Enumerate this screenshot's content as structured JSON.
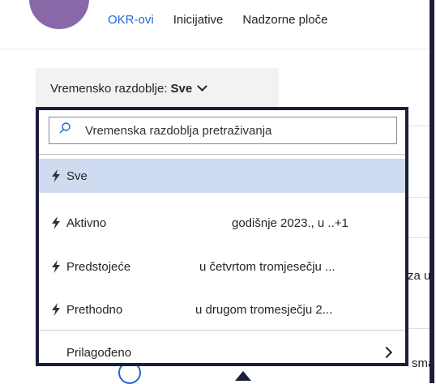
{
  "tabs": [
    {
      "label": "OKR-ovi"
    },
    {
      "label": "Inicijative"
    },
    {
      "label": "Nadzorne ploče"
    }
  ],
  "period_filter": {
    "label": "Vremensko razdoblje:",
    "value": "Sve"
  },
  "background_fragments": {
    "row_a": "za u",
    "row_b": "sma"
  },
  "dropdown": {
    "search_placeholder": "Vremenska razdoblja pretraživanja",
    "items": [
      {
        "label": "Sve",
        "detail": ""
      },
      {
        "label": "Aktivno",
        "detail": "godišnje 2023., u ..+1"
      },
      {
        "label": "Predstojeće",
        "detail": "u četvrtom tromjesečju ..."
      },
      {
        "label": "Prethodno",
        "detail": "u drugom tromesječju 2..."
      }
    ],
    "custom_label": "Prilagođeno"
  },
  "colors": {
    "accent": "#2564cf",
    "selected_bg": "#cfdbf0",
    "highlight_border": "#1b1f3b",
    "avatar": "#8a68a8"
  }
}
